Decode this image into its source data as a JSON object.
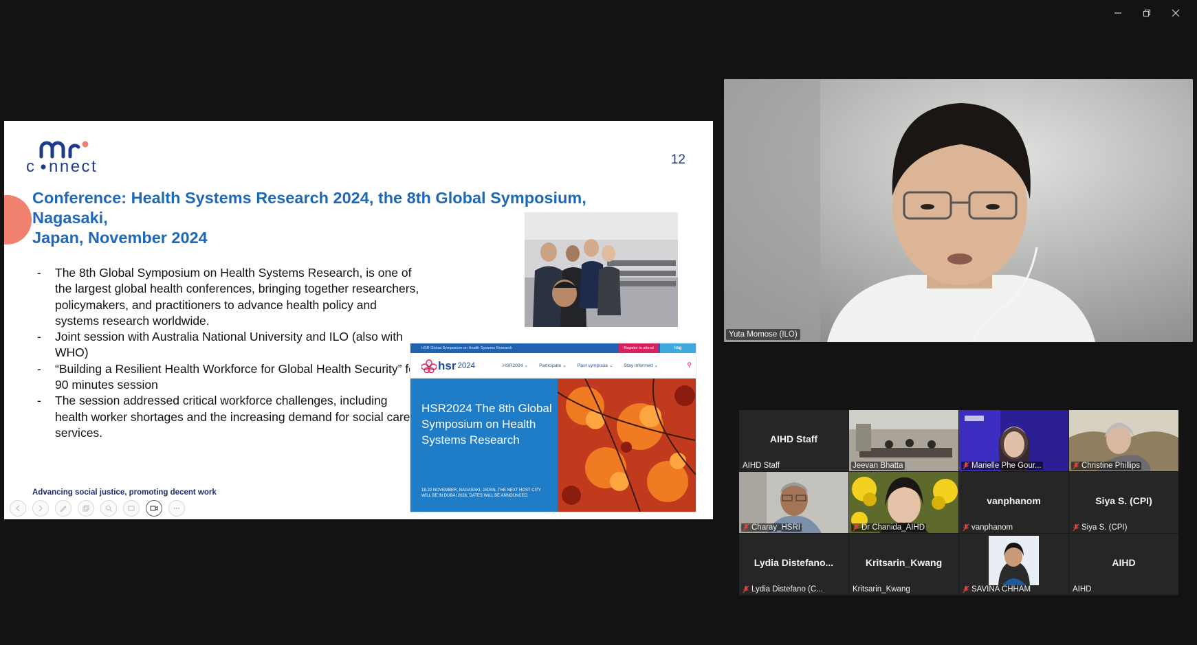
{
  "window_controls": [
    "minimize",
    "restore",
    "close"
  ],
  "slide": {
    "page_number": "12",
    "title_line1": "Conference: Health Systems Research 2024, the 8th Global Symposium, Nagasaki,",
    "title_line2": "Japan, November 2024",
    "bullets": [
      "The 8th Global Symposium on Health Systems Research, is one of the largest global health conferences, bringing together researchers, policymakers, and practitioners to advance health policy and systems research worldwide.",
      "Joint session with Australia National University and ILO (also with WHO)",
      "“Building a Resilient Health Workforce for Global Health Security” for 90 minutes session",
      "The session addressed critical workforce challenges, including health worker shortages and the increasing demand for social care services."
    ],
    "footer": "Advancing social justice, promoting decent work",
    "logo": "connect-logo",
    "website": {
      "topbar_text": "HSR Global Symposium on Health Systems Research",
      "register_label": "Register to attend",
      "hsg_label": "hsg",
      "brand_hsr": "hsr",
      "brand_year": "2024",
      "menu": [
        "HSR2024 ⌄",
        "Participate ⌄",
        "Past symposia ⌄",
        "Stay informed ⌄"
      ],
      "hero_title": "HSR2024 The 8th Global Symposium on Health Systems Research",
      "hero_small": "18-22 NOVEMBER, NAGASAKI, JAPAN. THE NEXT HOST CITY WILL BE IN DUBAI 2026, DATES WILL BE ANNOUNCED."
    },
    "toolbar_icons": [
      "prev-icon",
      "next-icon",
      "pen-icon",
      "copy-icon",
      "zoom-icon",
      "slides-icon",
      "camera-icon",
      "more-icon"
    ]
  },
  "speaker": {
    "name": "Yuta Momose (ILO)"
  },
  "gallery": {
    "tiles": [
      {
        "big": "AIHD Staff",
        "label": "AIHD Staff",
        "muted": false,
        "video": false
      },
      {
        "big": "",
        "label": "Jeevan Bhatta",
        "muted": false,
        "video": true
      },
      {
        "big": "",
        "label": "Marielle Phe Gour...",
        "muted": true,
        "video": true
      },
      {
        "big": "",
        "label": "Christine Phillips",
        "muted": true,
        "video": true
      },
      {
        "big": "",
        "label": "Charay_HSRI",
        "muted": true,
        "video": true
      },
      {
        "big": "",
        "label": "Dr Chanida_AIHD",
        "muted": true,
        "video": true
      },
      {
        "big": "vanphanom",
        "label": "vanphanom",
        "muted": true,
        "video": false
      },
      {
        "big": "Siya S. (CPI)",
        "label": "Siya S. (CPI)",
        "muted": true,
        "video": false
      },
      {
        "big": "Lydia  Distefano...",
        "label": "Lydia Distefano (C...",
        "muted": true,
        "video": false
      },
      {
        "big": "Kritsarin_Kwang",
        "label": "Kritsarin_Kwang",
        "muted": false,
        "video": false
      },
      {
        "big": "",
        "label": "SAVINA CHHAM",
        "muted": true,
        "video": false
      },
      {
        "big": "AIHD",
        "label": "AIHD",
        "muted": false,
        "video": false
      }
    ]
  },
  "colors": {
    "background": "#131313",
    "title_blue": "#1f68b5",
    "accent_coral": "#f08070",
    "muted_red": "#e04040"
  }
}
